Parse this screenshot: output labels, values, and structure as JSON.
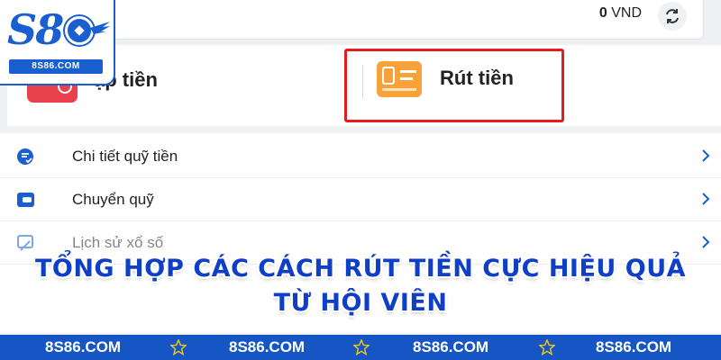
{
  "balance": {
    "amount": "0",
    "currency": "VND"
  },
  "actions": {
    "deposit_label": "ạp tiền",
    "withdraw_label": "Rút tiền"
  },
  "menu": {
    "items": [
      {
        "label": "Chi tiết quỹ tiền",
        "icon": "fund-details-icon"
      },
      {
        "label": "Chuyển quỹ",
        "icon": "wallet-icon"
      },
      {
        "label": "Lịch sử xổ số",
        "icon": "lottery-history-icon"
      }
    ]
  },
  "banner": {
    "line1": "TỔNG HỢP CÁC CÁCH RÚT TIỀN CỰC HIỆU QUẢ",
    "line2": "TỪ HỘI VIÊN"
  },
  "footer": {
    "items": [
      "8S86.COM",
      "8S86.COM",
      "8S86.COM",
      "8S86.COM"
    ]
  },
  "logo": {
    "main": "S8",
    "sub": "8S86.COM"
  },
  "colors": {
    "brand_blue": "#1a5fd0",
    "highlight_red": "#e31b23",
    "deposit_red": "#e9404d",
    "withdraw_orange": "#f7a33a",
    "footer_blue": "#1656c4",
    "star_gold": "#f5c518"
  }
}
